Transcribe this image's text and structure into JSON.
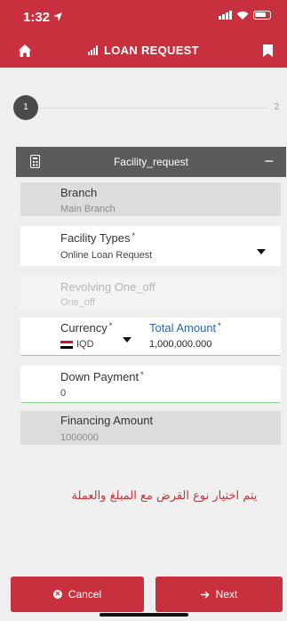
{
  "status_bar": {
    "time": "1:32"
  },
  "app_bar": {
    "title": "LOAN REQUEST"
  },
  "stepper": {
    "step_one": "1",
    "step_two": "2"
  },
  "section": {
    "title": "Facility_request",
    "collapse_symbol": "−"
  },
  "fields": {
    "branch": {
      "label": "Branch",
      "value": "Main Branch"
    },
    "facility_types": {
      "label": "Facility Types",
      "required": "*",
      "value": "Online Loan Request"
    },
    "revolving": {
      "label": "Revolving One_off",
      "value": "One_off"
    },
    "currency": {
      "label": "Currency",
      "required": "*",
      "value": "IQD"
    },
    "total_amount": {
      "label": "Total Amount",
      "required": "*",
      "value": "1,000,000.000"
    },
    "down_payment": {
      "label": "Down Payment",
      "required": "*",
      "value": "0"
    },
    "financing_amount": {
      "label": "Financing Amount",
      "value": "1000000"
    }
  },
  "caption": "يتم اختيار نوع القرض مع المبلغ والعملة",
  "buttons": {
    "cancel": "Cancel",
    "next": "Next"
  },
  "colors": {
    "brand_red": "#c7303c",
    "section_gray": "#5b5b5b",
    "focus_green": "#8fcf8f",
    "link_blue": "#2a66b5"
  },
  "icons": {
    "home": "home-icon",
    "title": "bar-chart-icon",
    "bookmark": "bookmark-icon",
    "section": "calculator-icon",
    "cancel": "close-circle-icon",
    "next": "arrow-right-icon"
  }
}
